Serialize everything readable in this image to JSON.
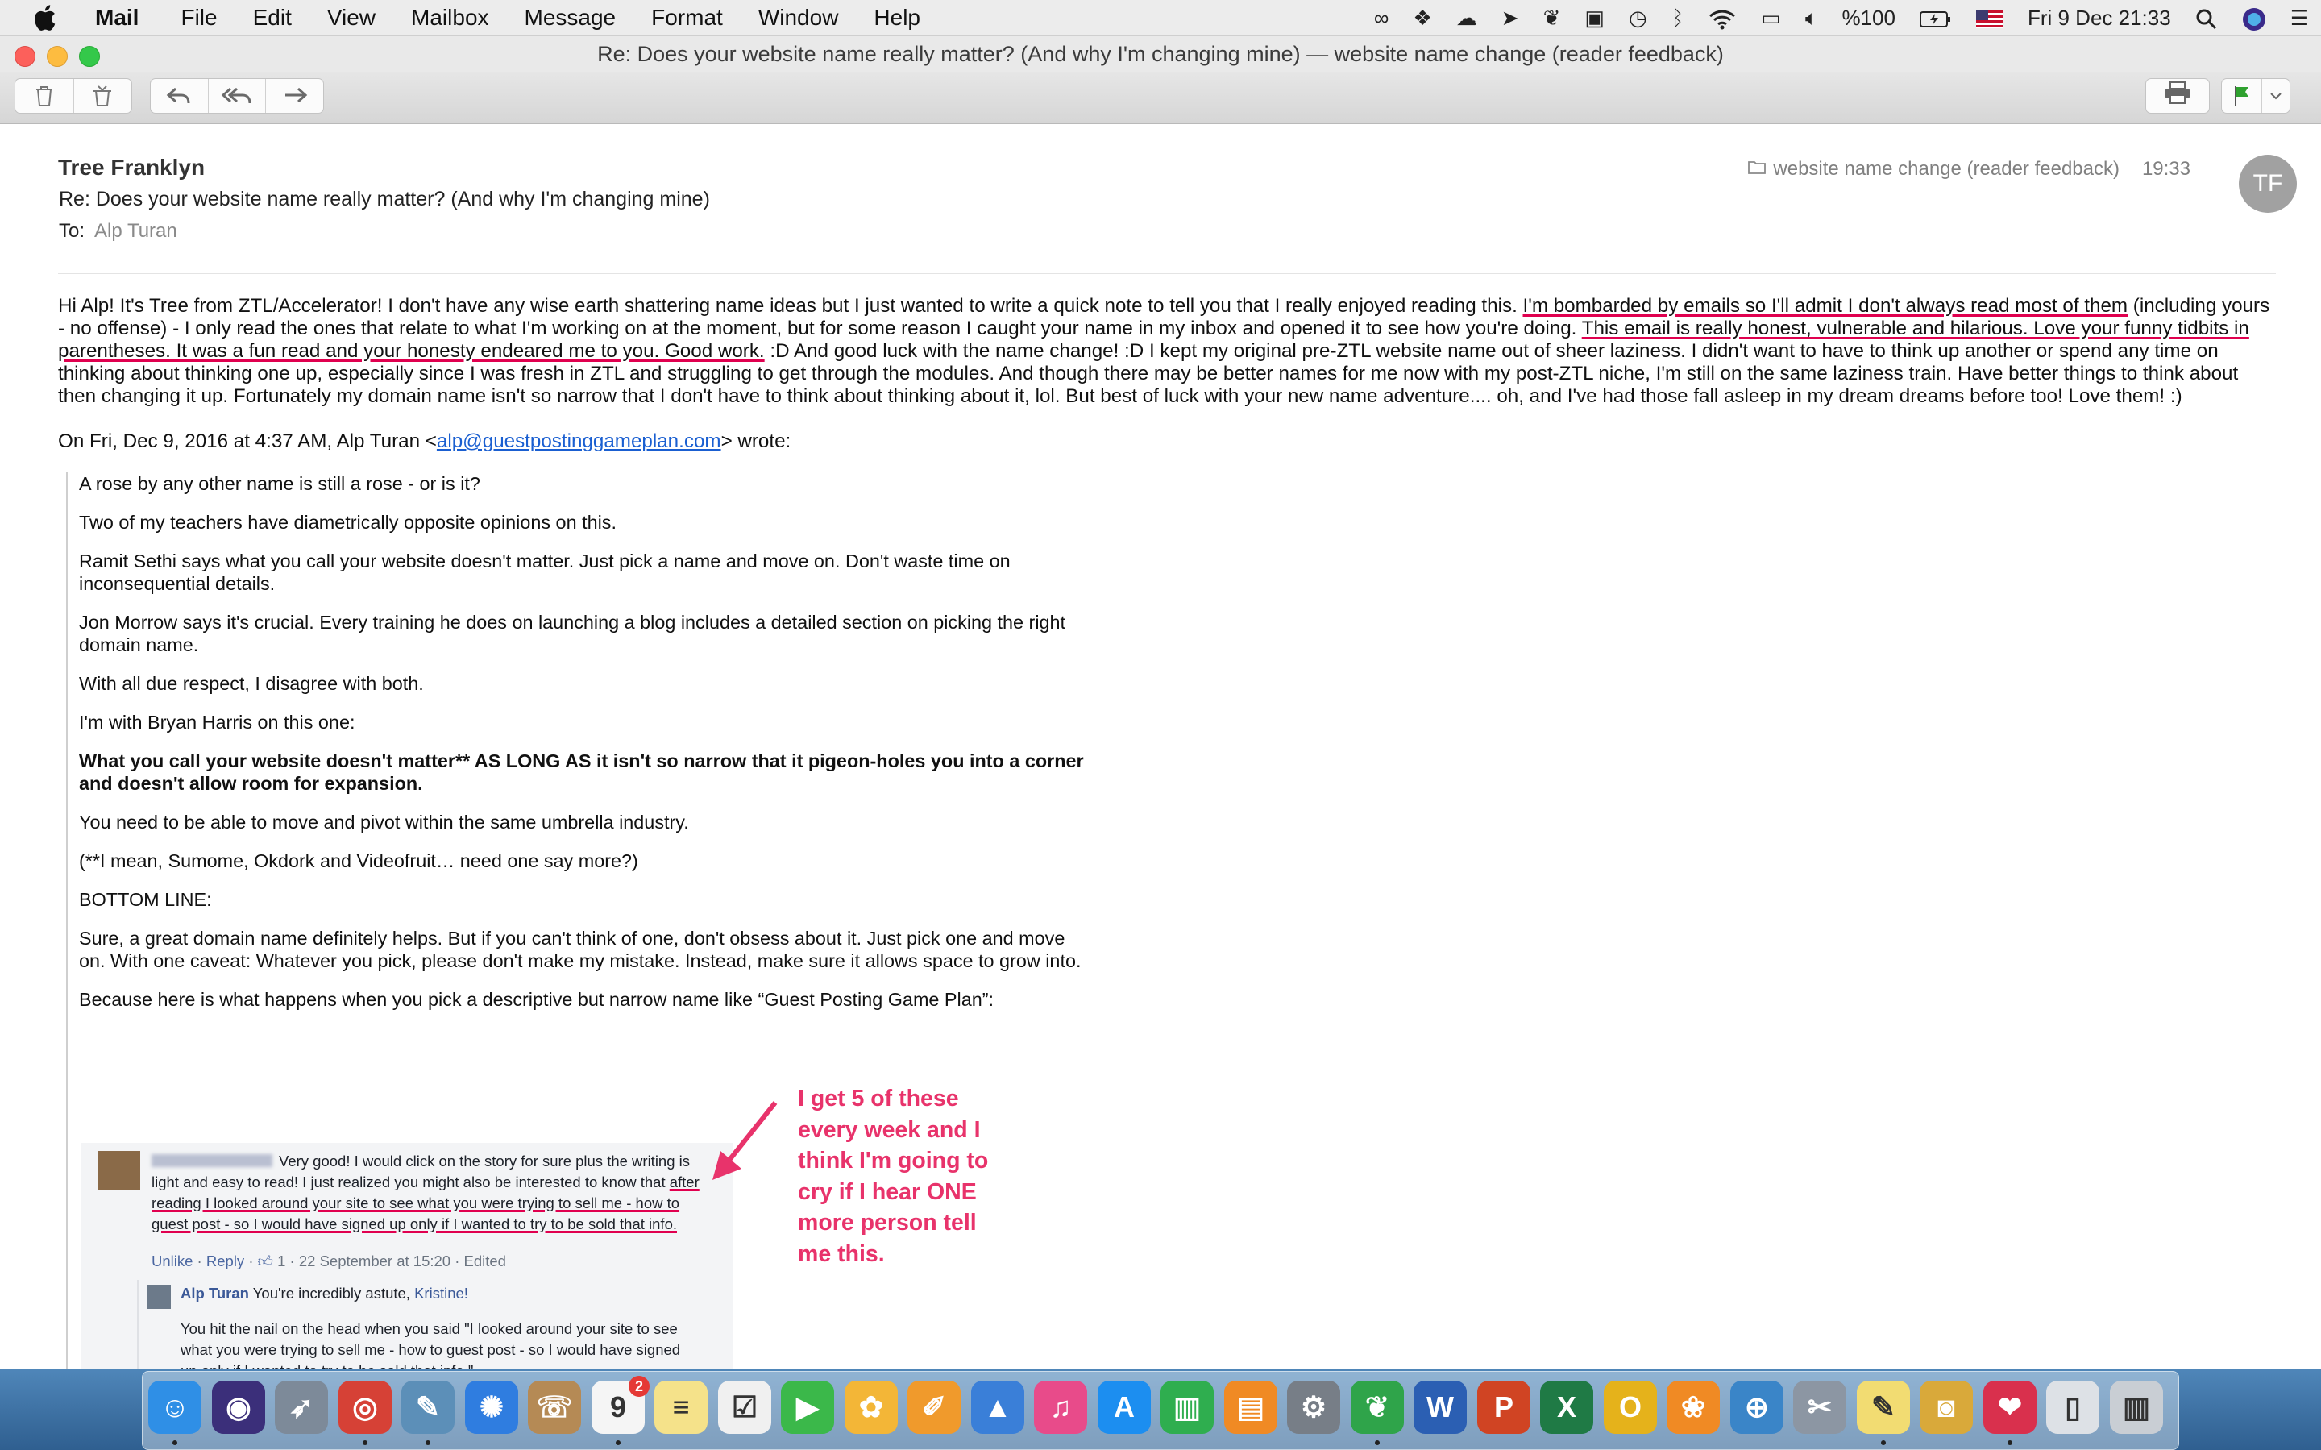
{
  "menubar": {
    "app_name": "Mail",
    "items": [
      "File",
      "Edit",
      "View",
      "Mailbox",
      "Message",
      "Format",
      "Window",
      "Help"
    ],
    "battery": "%100",
    "clock": "Fri 9 Dec  21:33",
    "status_icons": [
      "creative-cloud-icon",
      "dropbox-icon",
      "cloud-icon",
      "send-icon",
      "evernote-icon",
      "clipboard-icon",
      "time-machine-icon",
      "bluetooth-icon",
      "wifi-icon",
      "airplay-icon",
      "volume-icon",
      "battery-icon",
      "flag-us-icon",
      "search-icon",
      "siri-icon",
      "list-icon"
    ]
  },
  "window": {
    "title": "Re: Does your website name really matter? (And why I'm changing mine) — website name change (reader feedback)"
  },
  "toolbar": {
    "buttons": [
      "trash-icon",
      "junk-icon",
      "reply-icon",
      "reply-all-icon",
      "forward-icon",
      "print-icon",
      "flag-icon"
    ],
    "flag_color": "#2fa12f"
  },
  "message": {
    "sender": "Tree Franklyn",
    "subject": "Re: Does your website name really matter? (And why I'm changing mine)",
    "to_label": "To:",
    "recipient": "Alp Turan",
    "mailbox": "website name change (reader feedback)",
    "time": "19:33",
    "avatar_initials": "TF",
    "reply_parts": [
      "Hi Alp! It's Tree from ZTL/Accelerator! I don't have any wise earth shattering name ideas but I just wanted to write a quick note to tell you that I really enjoyed reading this. ",
      "I'm bombarded by emails so I'll admit I don't always read most of them",
      " (including yours - no offense) - I only read the ones that relate to what I'm working on at the moment, but for some reason I caught your name in my inbox and opened it to see how you're doing. ",
      "This email is really honest, vulnerable and hilarious. Love your funny tidbits in parentheses. It was a fun read and your honesty endeared me to you. Good work.",
      " :D And good luck with the name change! :D I kept my original pre-ZTL website name out of sheer laziness. I didn't want to have to think up another or spend any time on thinking about thinking one up, especially since I was fresh in ZTL and struggling to get through the modules. And though there may be better names for me now with my post-ZTL niche, I'm still on the same laziness train. Have better things to think about then changing it up. Fortunately my domain name isn't so narrow that I don't have to think about thinking about it, lol. But best of luck with your new name adventure.... oh, and I've had those fall asleep in my dream dreams before too! Love them! :)"
    ],
    "attribution_prefix": "On Fri, Dec 9, 2016 at 4:37 AM, Alp Turan <",
    "attribution_email": "alp@guestpostinggameplan.com",
    "attribution_suffix": "> wrote:",
    "quoted": [
      "A rose by any other name is still a rose - or is it?",
      "Two of my teachers have diametrically opposite opinions on this.",
      "Ramit Sethi says what you call your website doesn't matter. Just pick a name and move on. Don't waste time on inconsequential details.",
      "Jon Morrow says it's crucial. Every training he does on launching a blog includes a detailed section on picking the right domain name.",
      "With all due respect, I disagree with both.",
      "I'm with Bryan Harris on this one:",
      "What you call your website doesn't matter** AS LONG AS it isn't so narrow that it pigeon-holes you into a corner and doesn't allow room for expansion.",
      "You need to be able to move and pivot within the same umbrella industry.",
      "(**I mean, Sumome, Okdork and Videofruit… need one say more?)",
      "BOTTOM LINE:",
      "Sure, a great domain name definitely helps. But if you can't think of one, don't obsess about it. Just pick one and move on. With one caveat: Whatever you pick, please don't make my mistake. Instead, make sure it allows space to grow into.",
      "Because here is what happens when you pick a descriptive but narrow name like “Guest Posting Game Plan”:"
    ],
    "embedded": {
      "comment_a": "Very good! I would click on the story for sure plus the writing is light and easy to read! I just realized you might also be interested to know that ",
      "comment_hl": "after reading I looked around your site to see what you were trying to sell me - how to guest post - so I would have signed up only if I wanted to try to be sold that info.",
      "meta_unlike": "Unlike",
      "meta_reply": "Reply",
      "meta_rest": "1 · 22 September at 15:20 · Edited",
      "reply_name": "Alp Turan",
      "reply_text": "You're incredibly astute,",
      "reply_mention": "Kristine!",
      "reply_body": "You hit the nail on the head when you said \"I looked around your site to see what you were trying to sell me - how to guest post - so I would have signed up only if I wanted to try to be sold that info.\"",
      "annotation": "I get 5 of these every week and I think I'm going to cry if I hear ONE more person tell me this.",
      "annotation_color": "#e8336b"
    }
  },
  "dock": {
    "apps": [
      {
        "name": "finder",
        "color": "#2f8fe6",
        "glyph": "☺",
        "running": true
      },
      {
        "name": "siri",
        "color": "#3b2f7a",
        "glyph": "◉",
        "running": false
      },
      {
        "name": "launchpad",
        "color": "#7d8a99",
        "glyph": "➶",
        "running": false
      },
      {
        "name": "chrome",
        "color": "#d64136",
        "glyph": "◎",
        "running": true
      },
      {
        "name": "preview",
        "color": "#5c8fb8",
        "glyph": "✎",
        "running": true
      },
      {
        "name": "safari",
        "color": "#2f7de0",
        "glyph": "✺",
        "running": false
      },
      {
        "name": "contacts",
        "color": "#b58a55",
        "glyph": "☏",
        "running": false
      },
      {
        "name": "calendar",
        "color": "#f5f5f5",
        "glyph": "9",
        "running": true,
        "badge": "2"
      },
      {
        "name": "notes",
        "color": "#f5e28a",
        "glyph": "≡",
        "running": false
      },
      {
        "name": "reminders",
        "color": "#f0f0f0",
        "glyph": "☑",
        "running": false
      },
      {
        "name": "facetime",
        "color": "#3bb84a",
        "glyph": "▶",
        "running": false
      },
      {
        "name": "photos",
        "color": "#f3b637",
        "glyph": "✿",
        "running": false
      },
      {
        "name": "pages",
        "color": "#f09a2c",
        "glyph": "✐",
        "running": false
      },
      {
        "name": "keynote",
        "color": "#3a7fd8",
        "glyph": "▲",
        "running": false
      },
      {
        "name": "itunes",
        "color": "#e84b8a",
        "glyph": "♫",
        "running": false
      },
      {
        "name": "app-store",
        "color": "#1c8ef0",
        "glyph": "A",
        "running": false
      },
      {
        "name": "numbers",
        "color": "#2fae4f",
        "glyph": "▥",
        "running": false
      },
      {
        "name": "ibooks",
        "color": "#f08a24",
        "glyph": "▤",
        "running": false
      },
      {
        "name": "system-preferences",
        "color": "#777e87",
        "glyph": "⚙",
        "running": false
      },
      {
        "name": "evernote",
        "color": "#2fa44a",
        "glyph": "❦",
        "running": true
      },
      {
        "name": "word",
        "color": "#2b5fb3",
        "glyph": "W",
        "running": false
      },
      {
        "name": "powerpoint",
        "color": "#d04423",
        "glyph": "P",
        "running": false
      },
      {
        "name": "excel",
        "color": "#1f7a45",
        "glyph": "X",
        "running": false
      },
      {
        "name": "outlook",
        "color": "#e5b21b",
        "glyph": "O",
        "running": false
      },
      {
        "name": "butterfly",
        "color": "#f08a24",
        "glyph": "❀",
        "running": false
      },
      {
        "name": "globe",
        "color": "#3a85c8",
        "glyph": "⊕",
        "running": false
      },
      {
        "name": "tool",
        "color": "#8c96a3",
        "glyph": "✂",
        "running": false
      },
      {
        "name": "stickies",
        "color": "#f2dc72",
        "glyph": "✎",
        "running": true
      },
      {
        "name": "jar",
        "color": "#d9a93a",
        "glyph": "◙",
        "running": false
      },
      {
        "name": "lips",
        "color": "#d9304d",
        "glyph": "❤",
        "running": true
      },
      {
        "name": "archive",
        "color": "#dde1e6",
        "glyph": "▯",
        "running": false
      },
      {
        "name": "trash",
        "color": "#c9ced4",
        "glyph": "▥",
        "running": false
      }
    ]
  }
}
